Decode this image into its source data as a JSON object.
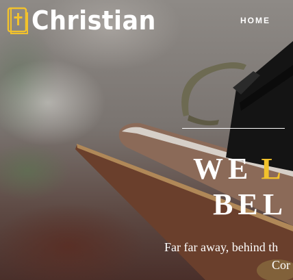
{
  "brand": {
    "name": "Christian",
    "icon": "bible-cross-icon"
  },
  "nav": {
    "items": [
      {
        "label": "HOME"
      }
    ]
  },
  "hero": {
    "headline_line1_white": "WE",
    "headline_line1_accent": "L",
    "headline_line2": "BEL",
    "tagline_line1": "Far far away, behind th",
    "tagline_line2": "Cor"
  },
  "colors": {
    "accent": "#f2c22c",
    "text": "#ffffff"
  }
}
